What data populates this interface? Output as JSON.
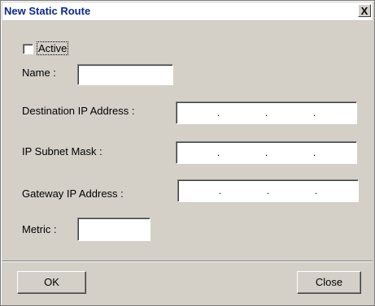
{
  "window": {
    "title": "New Static Route",
    "close_glyph": "X"
  },
  "active": {
    "label": "Active",
    "checked": false
  },
  "name": {
    "label": "Name :",
    "value": ""
  },
  "destination_ip": {
    "label": "Destination IP Address :",
    "dot": "."
  },
  "subnet_mask": {
    "label": "IP Subnet Mask :",
    "dot": "."
  },
  "gateway_ip": {
    "label": "Gateway IP Address :",
    "dot": "."
  },
  "metric": {
    "label": "Metric :",
    "value": ""
  },
  "buttons": {
    "ok": "OK",
    "close": "Close"
  }
}
